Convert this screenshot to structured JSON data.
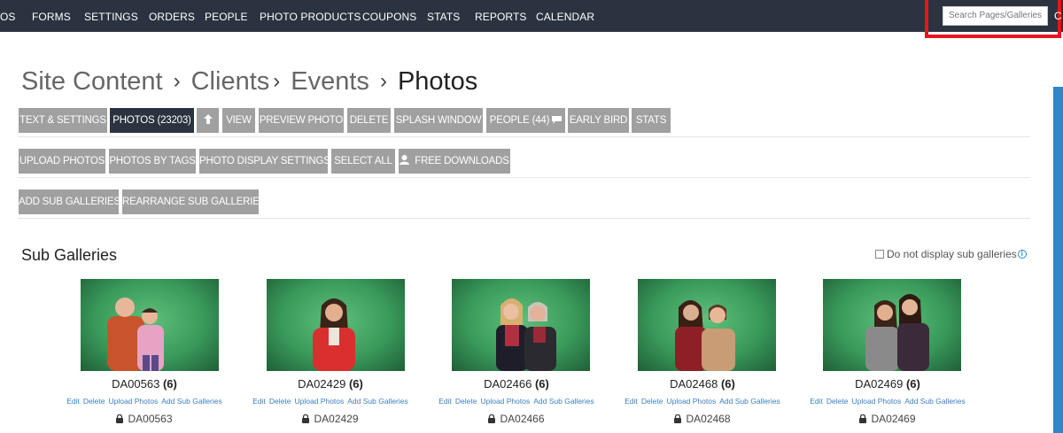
{
  "nav": {
    "items": [
      {
        "label": "OS",
        "key": "photos"
      },
      {
        "label": "FORMS",
        "key": "forms"
      },
      {
        "label": "SETTINGS",
        "key": "settings"
      },
      {
        "label": "ORDERS",
        "key": "orders"
      },
      {
        "label": "PEOPLE",
        "key": "people"
      },
      {
        "label": "PHOTO PRODUCTS",
        "key": "photo-products"
      },
      {
        "label": "COUPONS",
        "key": "coupons"
      },
      {
        "label": "STATS",
        "key": "stats"
      },
      {
        "label": "REPORTS",
        "key": "reports"
      },
      {
        "label": "CALENDAR",
        "key": "calendar"
      }
    ],
    "search_placeholder": "Search Pages/Galleries",
    "overflow_char": "C"
  },
  "breadcrumb": {
    "items": [
      "Site Content",
      "Clients",
      "Events"
    ],
    "separator": "›",
    "current": "Photos"
  },
  "toolbar": {
    "row1": {
      "text_settings": "TEXT & SETTINGS",
      "photos": "PHOTOS (23203)",
      "view": "VIEW",
      "preview_photo": "PREVIEW PHOTO",
      "delete": "DELETE",
      "splash_window": "SPLASH WINDOW",
      "people": "PEOPLE (44)",
      "early_bird": "EARLY BIRD",
      "stats": "STATS"
    },
    "row2": {
      "upload_photos": "UPLOAD PHOTOS",
      "photos_by_tags": "PHOTOS BY TAGS",
      "photo_display_settings": "PHOTO DISPLAY SETTINGS",
      "select_all": "SELECT ALL",
      "free_downloads": "FREE DOWNLOADS"
    },
    "row3": {
      "add_sub_galleries": "ADD SUB GALLERIES",
      "rearrange_sub_galleries": "REARRANGE SUB GALLERIES"
    }
  },
  "sub_galleries": {
    "title": "Sub Galleries",
    "option_label": "Do not display sub galleries",
    "info_glyph": "i",
    "link_labels": {
      "edit": "Edit",
      "delete": "Delete",
      "upload": "Upload Photos",
      "add": "Add Sub Galleries"
    },
    "items": [
      {
        "name": "DA00563",
        "count": "(6)",
        "lock_name": "DA00563"
      },
      {
        "name": "DA02429",
        "count": "(6)",
        "lock_name": "DA02429"
      },
      {
        "name": "DA02466",
        "count": "(6)",
        "lock_name": "DA02466"
      },
      {
        "name": "DA02468",
        "count": "(6)",
        "lock_name": "DA02468"
      },
      {
        "name": "DA02469",
        "count": "(6)",
        "lock_name": "DA02469"
      }
    ]
  },
  "colors": {
    "nav_bg": "#2b3340",
    "button_bg": "#a0a0a0",
    "button_active_bg": "#2b3340",
    "highlight": "#e8141f",
    "link": "#3a7fc1",
    "accent_tab": "#2f86c8"
  }
}
